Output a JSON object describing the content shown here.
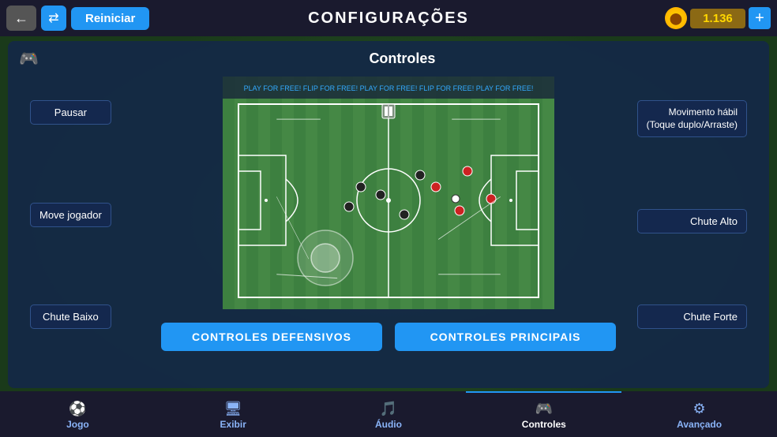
{
  "header": {
    "back_label": "←",
    "shuffle_label": "⇄",
    "reiniciar_label": "Reiniciar",
    "title": "CONFIGURAÇÕES",
    "coin_value": "1.136",
    "add_label": "+"
  },
  "section": {
    "title": "Controles",
    "gamepad_icon": "🎮"
  },
  "labels": {
    "left": {
      "pausar": "Pausar",
      "move_jogador": "Move jogador",
      "chute_baixo": "Chute Baixo"
    },
    "right": {
      "movimento": "Movimento hábil\n(Toque duplo/Arraste)",
      "chute_alto": "Chute Alto",
      "chute_forte": "Chute Forte"
    }
  },
  "buttons": {
    "controles_defensivos": "CONTROLES DEFENSIVOS",
    "controles_principais": "CONTROLES PRINCIPAIS"
  },
  "nav": {
    "items": [
      {
        "label": "Jogo",
        "icon": "⚽",
        "active": false
      },
      {
        "label": "Exibir",
        "icon": "🖥",
        "active": false
      },
      {
        "label": "Áudio",
        "icon": "🎵",
        "active": false
      },
      {
        "label": "Controles",
        "icon": "🎮",
        "active": true
      },
      {
        "label": "Avançado",
        "icon": "⚙",
        "active": false
      }
    ]
  }
}
